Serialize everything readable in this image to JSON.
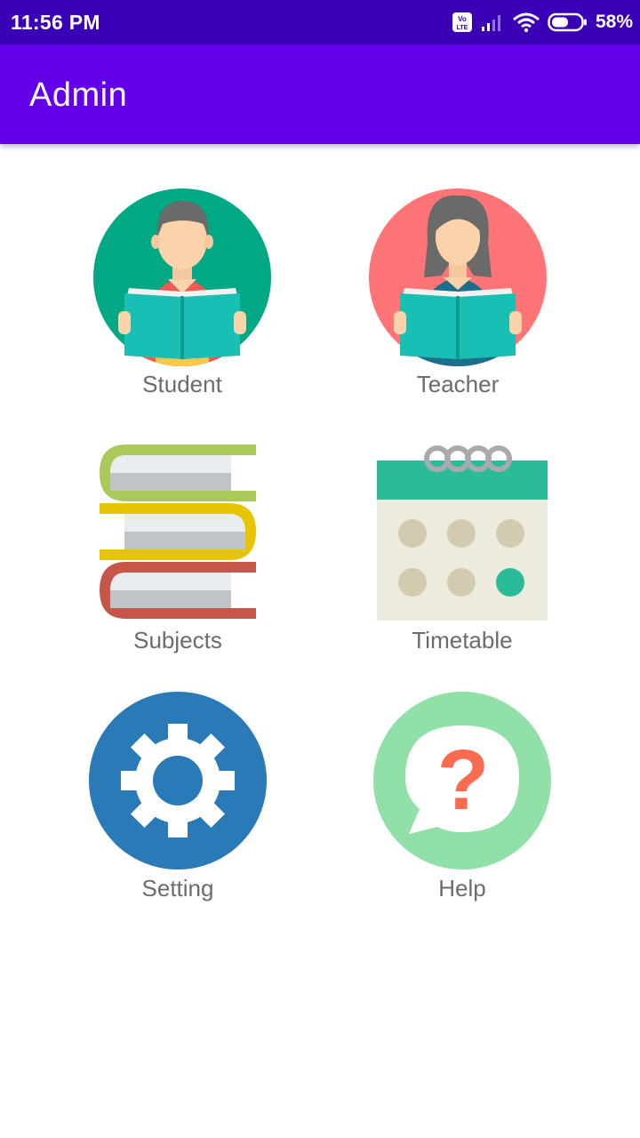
{
  "status_bar": {
    "time": "11:56 PM",
    "volte_label": "Vo LTE",
    "battery_percent": "58%",
    "battery_level": 0.58,
    "icons": [
      "volte-icon",
      "signal-icon",
      "wifi-icon",
      "battery-icon"
    ]
  },
  "app_bar": {
    "title": "Admin"
  },
  "menu": [
    {
      "label": "Student",
      "icon": "student-icon"
    },
    {
      "label": "Teacher",
      "icon": "teacher-icon"
    },
    {
      "label": "Subjects",
      "icon": "books-icon"
    },
    {
      "label": "Timetable",
      "icon": "calendar-icon"
    },
    {
      "label": "Setting",
      "icon": "gear-icon"
    },
    {
      "label": "Help",
      "icon": "help-icon"
    }
  ],
  "colors": {
    "status_bar": "#3a00b5",
    "app_bar": "#6200ea",
    "label_text": "#6b6b6b",
    "student_bg": "#00a884",
    "teacher_bg": "#ff7577",
    "setting_bg": "#2a7ab8",
    "help_bg": "#90e0a8",
    "calendar_header": "#2bbb99"
  }
}
